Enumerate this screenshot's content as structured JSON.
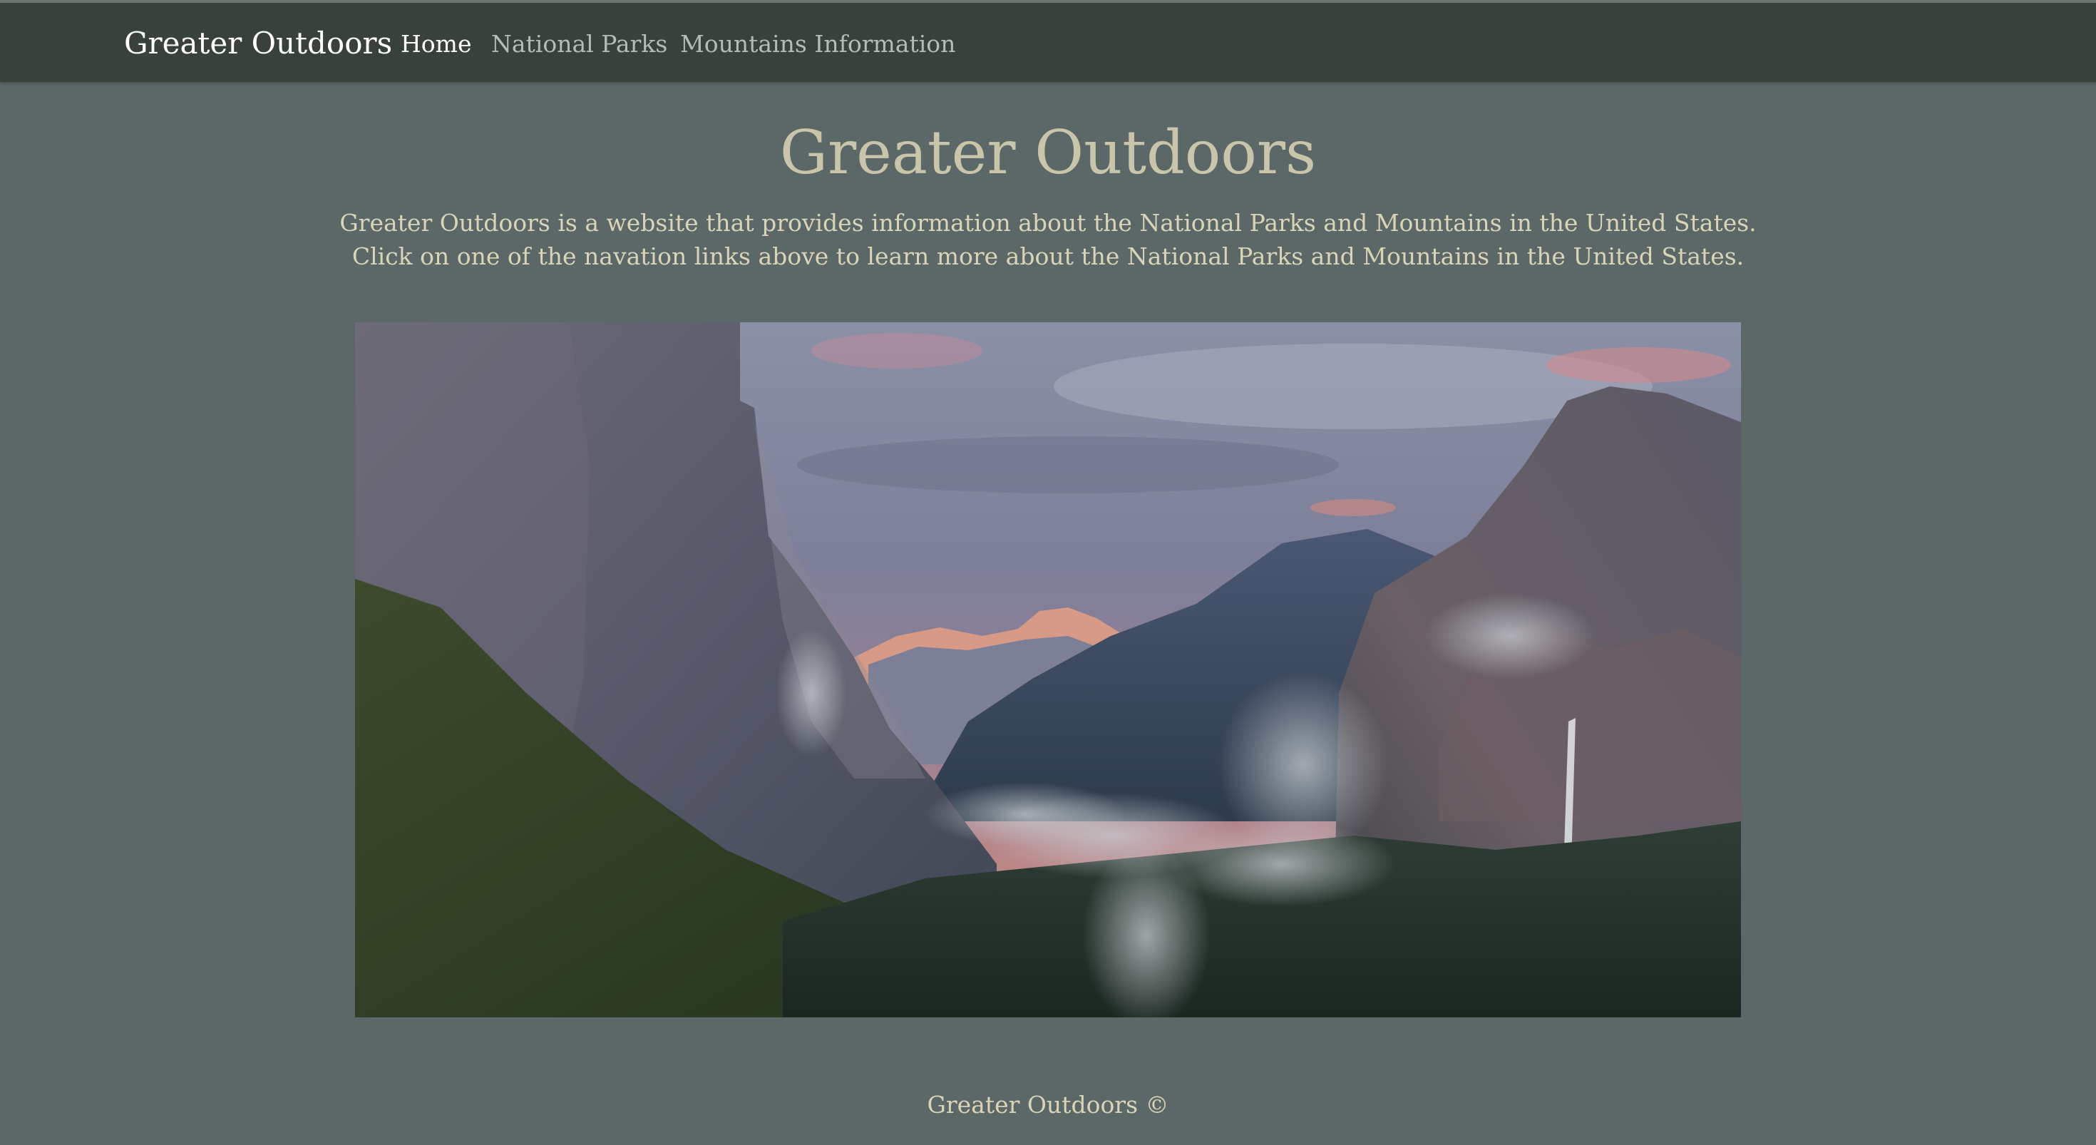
{
  "navbar": {
    "brand": "Greater Outdoors",
    "links": [
      {
        "label": "Home",
        "active": true
      },
      {
        "label": "National Parks",
        "active": false
      },
      {
        "label": "Mountains Information",
        "active": false
      }
    ]
  },
  "hero": {
    "title": "Greater Outdoors",
    "description_line1": "Greater Outdoors is a website that provides information about the National Parks and Mountains in the United States.",
    "description_line2": "Click on one of the navation links above to learn more about the National Parks and Mountains in the United States."
  },
  "footer": {
    "text": "Greater Outdoors ©"
  },
  "colors": {
    "page_background": "#5c6867",
    "navbar_background": "#38423b",
    "title_color": "#c8c5aa",
    "text_color": "#d8d4b8",
    "nav_inactive": "#b6bbb5"
  }
}
